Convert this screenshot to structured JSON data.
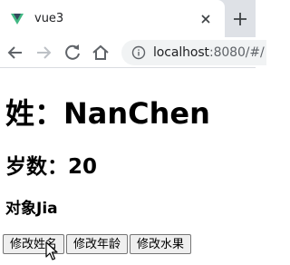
{
  "browser": {
    "tab_title": "vue3",
    "url_host": "localhost",
    "url_rest": ":8080/#/"
  },
  "content": {
    "name_line": "姓：NanChen",
    "age_line": "岁数：20",
    "object_line": "对象Jia",
    "buttons": {
      "change_name": "修改姓名",
      "change_age": "修改年龄",
      "change_fruit": "修改水果"
    }
  },
  "icons": {
    "favicon": "vue-logo-icon",
    "tab_close": "close-icon",
    "new_tab": "plus-icon",
    "back": "arrow-left-icon",
    "forward": "arrow-right-icon",
    "reload": "reload-icon",
    "home": "home-icon",
    "site_info": "info-icon",
    "cursor": "mouse-pointer-icon"
  },
  "colors": {
    "tabstrip_bg": "#dee1e6",
    "omnibox_bg": "#f1f3f4",
    "vue_green": "#41b883",
    "vue_dark": "#35495e",
    "button_bg": "#efefef"
  }
}
